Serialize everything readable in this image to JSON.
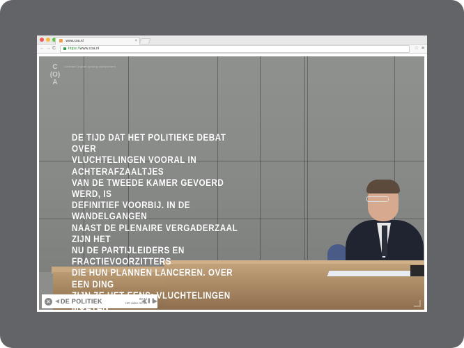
{
  "browser": {
    "tab_title": "www.coa.nl",
    "tab_close": "×",
    "url_scheme": "https://",
    "url_host": "www.coa.nl",
    "back": "←",
    "forward": "→",
    "reload": "C",
    "star": "☆",
    "menu": "≡",
    "colors": {
      "close": "#ee5a52",
      "minimize": "#f6bb3c",
      "maximize": "#5ec440"
    }
  },
  "page": {
    "brand_lines": [
      "C",
      "(O)",
      "A"
    ],
    "brand_subtitle": "Centraal Orgaan opvang asielzoekers",
    "quote": "DE TIJD DAT HET POLITIEKE DEBAT OVER\nVLUCHTELINGEN VOORAL IN ACHTERAFZAALTJES\nVAN DE TWEEDE KAMER GEVOERD WERD, IS\nDEFINITIEF VOORBIJ. IN DE WANDELGANGEN\nNAAST DE PLENAIRE VERGADERZAAL ZIJN HET\nNU DE PARTIJLEIDERS EN FRACTIEVOORZITTERS\nDIE HUN PLANNEN LANCEREN. OVER EEN DING\nZIJN ZE HET EENS: VLUCHTELINGEN MOETEN\n‘FATSOENLIJKE OPVANG IN DE REGIO’ KRIJGEN."
  },
  "player": {
    "close": "×",
    "back_arrow": "◀",
    "chapter": "DE POLITIEK",
    "time": "00:44",
    "video_label": "HD video",
    "duration": "12:50",
    "prev": "◀",
    "pause": "❚❚",
    "next": "▶"
  }
}
